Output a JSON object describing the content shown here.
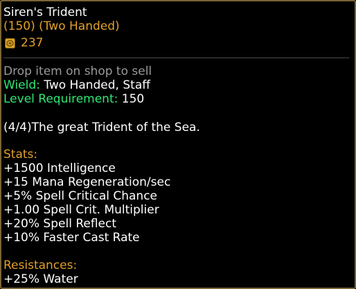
{
  "colors": {
    "gold": "#e2a02a",
    "gray": "#9a9a9a",
    "green": "#2ee875",
    "white": "#ffffff",
    "border": "#7a6536"
  },
  "item": {
    "name": "Siren's Trident",
    "subtitle": "(150) (Two Handed)",
    "price_icon": "gold-coin-icon",
    "price": "237"
  },
  "info": {
    "sell_hint": "Drop item on shop to sell",
    "wield_label": "Wield:",
    "wield_value": "Two Handed, Staff",
    "level_label": "Level Requirement:",
    "level_value": "150"
  },
  "description": "(4/4)The great Trident of the Sea.",
  "stats": {
    "heading": "Stats:",
    "lines": [
      "+1500 Intelligence",
      "+15 Mana Regeneration/sec",
      "+5% Spell Critical Chance",
      "+1.00 Spell Crit. Multiplier",
      "+20% Spell Reflect",
      "+10% Faster Cast Rate"
    ]
  },
  "resistances": {
    "heading": "Resistances:",
    "lines": [
      "+25% Water"
    ]
  }
}
